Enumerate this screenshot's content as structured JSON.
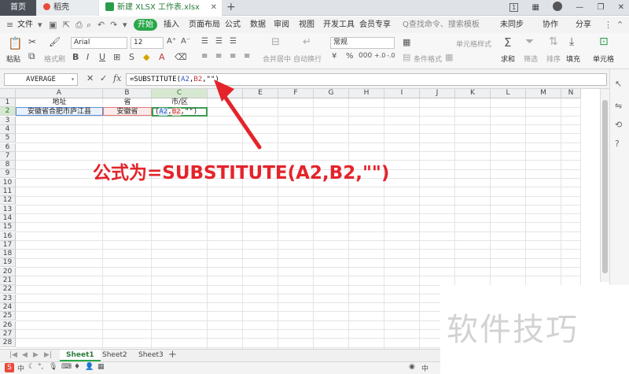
{
  "tabs": {
    "home": "首页",
    "draft": "稻壳",
    "document": "新建 XLSX 工作表.xlsx",
    "add": "+"
  },
  "window": {
    "badge": "1"
  },
  "menu": {
    "file": "文件",
    "start": "开始",
    "items": [
      "插入",
      "页面布局",
      "公式",
      "数据",
      "审阅",
      "视图",
      "开发工具",
      "会员专享"
    ],
    "search": "Q查找命令、搜索模板",
    "sync": "未同步",
    "collab": "协作",
    "share": "分享"
  },
  "ribbon": {
    "paste": "粘贴",
    "format_painter": "格式刷",
    "font_name": "Arial",
    "font_size": "12",
    "align_merge": "合并居中",
    "wrap": "自动换行",
    "number_format": "常规",
    "cond_format": "条件格式",
    "table_style": "表格样式",
    "cell_style": "单元格样式",
    "sum": "求和",
    "filter": "筛选",
    "sort": "排序",
    "fill": "填充",
    "cells": "单元格"
  },
  "formula_bar": {
    "name_box": "AVERAGE",
    "fx": "fx",
    "prefix": "=SUBSTITUTE(",
    "ref1": "A2",
    "sep1": ",",
    "ref2": "B2",
    "suffix": ",\"\")"
  },
  "grid": {
    "columns": [
      "A",
      "B",
      "C",
      "D",
      "E",
      "F",
      "G",
      "H",
      "I",
      "J",
      "K",
      "L",
      "M",
      "N"
    ],
    "rows": [
      "1",
      "2",
      "3",
      "4",
      "5",
      "6",
      "7",
      "8",
      "9",
      "10",
      "11",
      "12",
      "13",
      "14",
      "15",
      "16",
      "17",
      "18",
      "19",
      "20",
      "21",
      "22",
      "23",
      "24",
      "25",
      "26",
      "27",
      "28"
    ],
    "cells": {
      "A1": "地址",
      "B1": "省",
      "C1": "市/区",
      "A2": "安徽省合肥市庐江县",
      "B2": "安徽省",
      "C2_prefix": "(",
      "C2_ref1": "A2",
      "C2_sep": ",",
      "C2_ref2": "B2",
      "C2_suffix": ",\"\")"
    }
  },
  "annotation": "公式为=SUBSTITUTE(A2,B2,\"\")",
  "watermark": "软件技巧",
  "sheets": [
    "Sheet1",
    "Sheet2",
    "Sheet3"
  ],
  "status": {
    "ime": "中"
  },
  "colors": {
    "accent_green": "#2aa84a",
    "annotation_red": "#e3242b",
    "ref_blue": "#2b57c9",
    "ref_red": "#c23838"
  }
}
